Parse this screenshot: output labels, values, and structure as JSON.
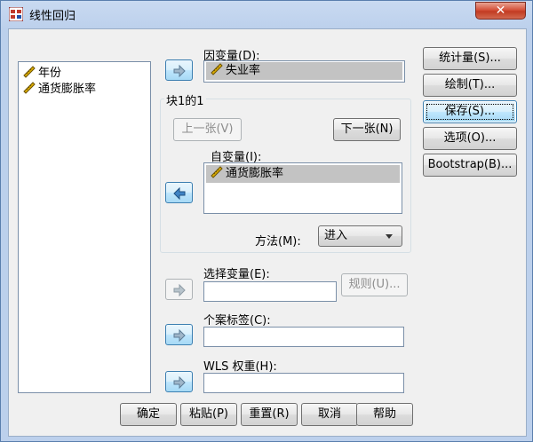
{
  "window": {
    "title": "线性回归",
    "close_symbol": "✕"
  },
  "source_list": {
    "items": [
      {
        "label": "年份",
        "icon": "ruler-scale-icon"
      },
      {
        "label": "通货膨胀率",
        "icon": "ruler-scale-icon"
      }
    ]
  },
  "dependent": {
    "label": "因变量(D):",
    "value": "失业率",
    "icon": "ruler-scale-icon"
  },
  "block": {
    "title": "块1的1",
    "prev_label": "上一张(V)",
    "next_label": "下一张(N)",
    "independent_label": "自变量(I):",
    "independent_items": [
      {
        "label": "通货膨胀率",
        "icon": "ruler-scale-icon"
      }
    ],
    "method_label": "方法(M):",
    "method_value": "进入"
  },
  "selection": {
    "label": "选择变量(E):",
    "value": "",
    "rule_label": "规则(U)..."
  },
  "case_labels": {
    "label": "个案标签(C):",
    "value": ""
  },
  "wls": {
    "label": "WLS 权重(H):",
    "value": ""
  },
  "side_buttons": {
    "statistics": "统计量(S)...",
    "plots": "绘制(T)...",
    "save": "保存(S)...",
    "options": "选项(O)...",
    "bootstrap": "Bootstrap(B)..."
  },
  "bottom_buttons": {
    "ok": "确定",
    "paste": "粘贴(P)",
    "reset": "重置(R)",
    "cancel": "取消",
    "help": "帮助"
  },
  "colors": {
    "accent": "#3c7fb1",
    "selection": "#c3c3c3",
    "close": "#c23b22",
    "ruler": "#e0b000"
  }
}
